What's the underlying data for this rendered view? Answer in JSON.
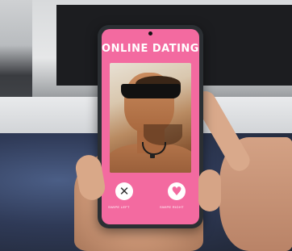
{
  "app": {
    "title": "ONLINE DATING",
    "accent_color": "#f36aa0"
  },
  "actions": {
    "left": {
      "icon": "close-icon",
      "glyph": "✕",
      "caption": "SWIPE LEFT"
    },
    "right": {
      "icon": "heart-icon",
      "glyph": "♥",
      "caption": "SWIPE RIGHT"
    }
  },
  "profile": {
    "photo_icon": "profile-photo"
  }
}
